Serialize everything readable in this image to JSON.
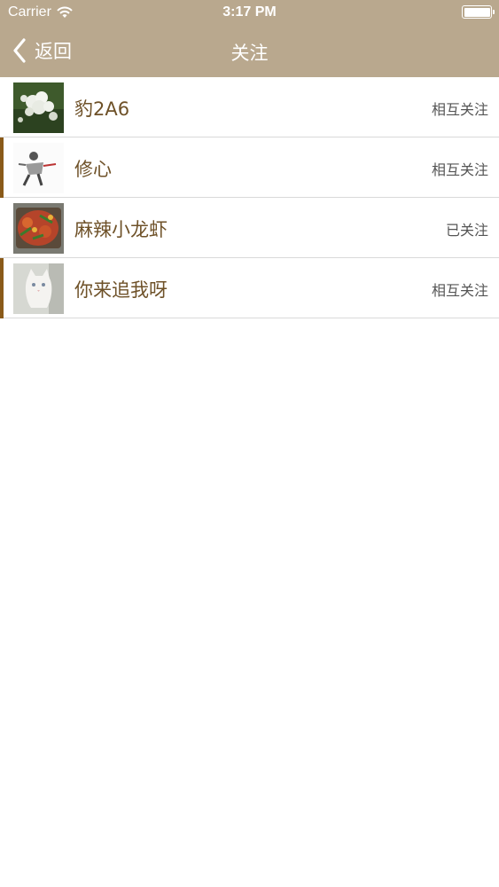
{
  "status_bar": {
    "carrier": "Carrier",
    "time": "3:17 PM",
    "battery_level": 1.0
  },
  "nav": {
    "back_label": "返回",
    "title": "关注"
  },
  "follows": [
    {
      "name": "豹2A6",
      "relation": "相互关注",
      "highlighted": false
    },
    {
      "name": "修心",
      "relation": "相互关注",
      "highlighted": true
    },
    {
      "name": "麻辣小龙虾",
      "relation": "已关注",
      "highlighted": false
    },
    {
      "name": "你来追我呀",
      "relation": "相互关注",
      "highlighted": true
    }
  ]
}
